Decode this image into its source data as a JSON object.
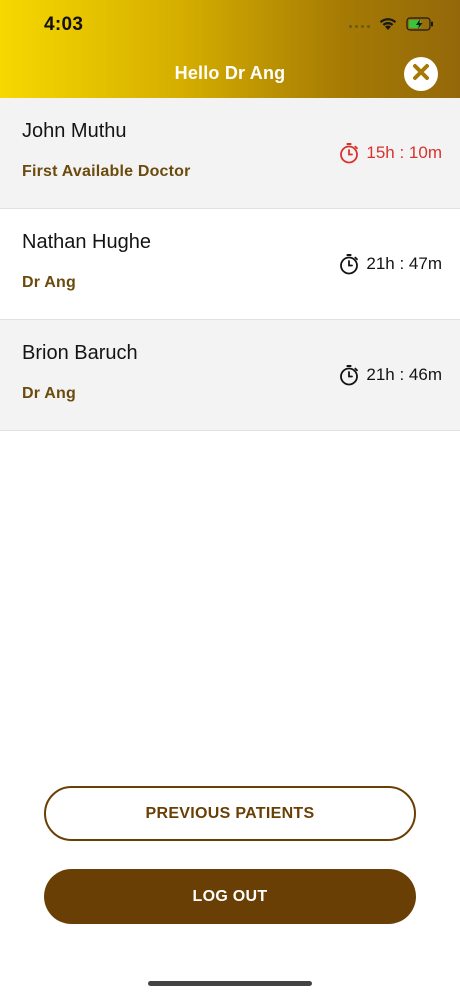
{
  "status_bar": {
    "time": "4:03"
  },
  "header": {
    "title": "Hello Dr Ang"
  },
  "patients": [
    {
      "name": "John Muthu",
      "doctor": "First Available Doctor",
      "wait": "15h : 10m",
      "overdue": true
    },
    {
      "name": "Nathan Hughe",
      "doctor": "Dr Ang",
      "wait": "21h : 47m",
      "overdue": false
    },
    {
      "name": "Brion Baruch",
      "doctor": "Dr Ang",
      "wait": "21h : 46m",
      "overdue": false
    }
  ],
  "buttons": {
    "previous_patients": "PREVIOUS PATIENTS",
    "logout": "LOG OUT"
  },
  "colors": {
    "brand_brown": "#6a3f06",
    "alert_red": "#d8332d",
    "header_gold": "#d4ad00"
  }
}
